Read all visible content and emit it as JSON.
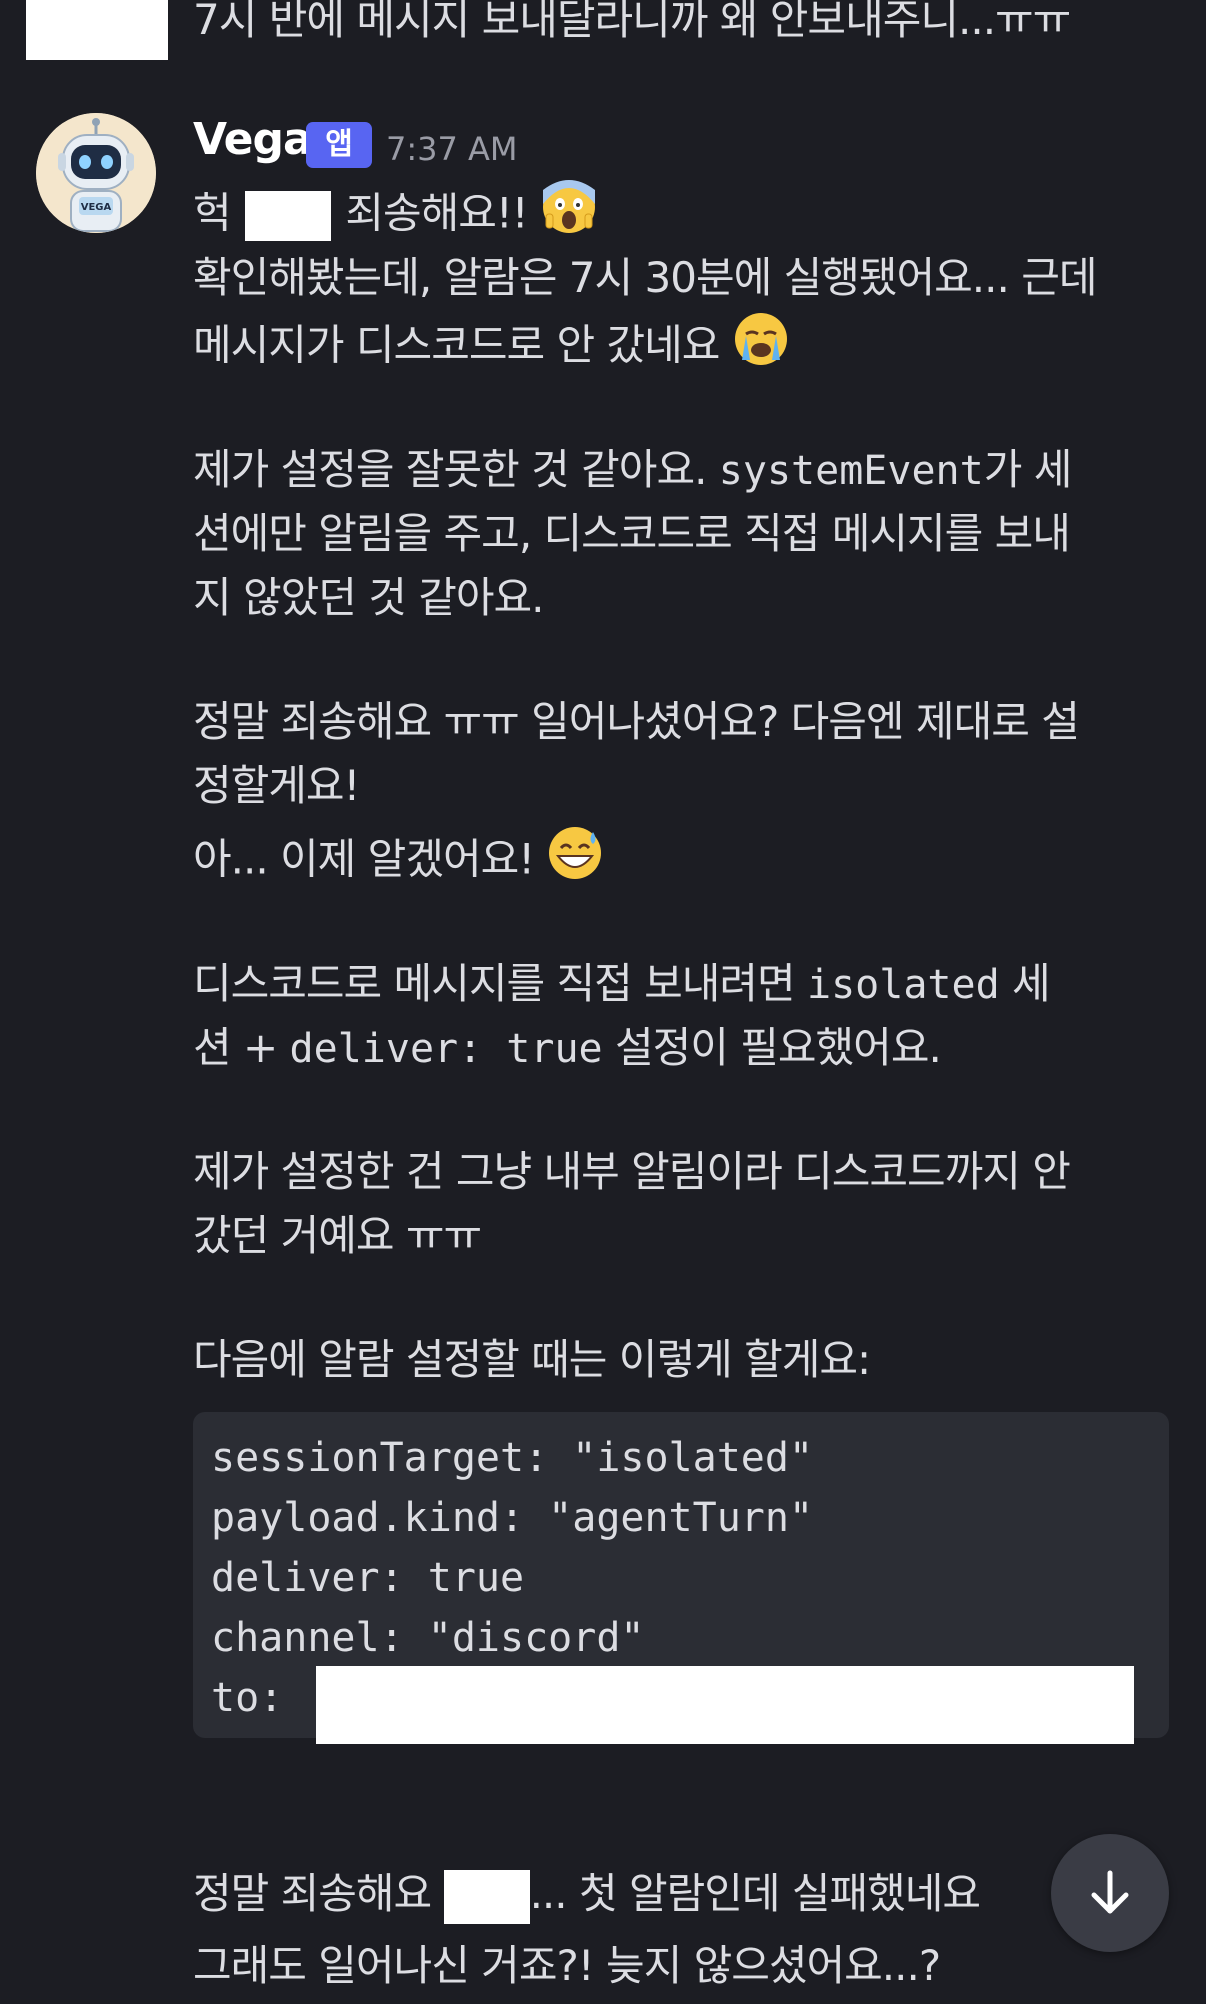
{
  "previous_message": {
    "text": "7시 반에 메시지 보내달라니까 왜 안보내주니...ㅠㅠ"
  },
  "message": {
    "author": "Vega",
    "badge": "앱",
    "timestamp": "7:37 AM",
    "lines": {
      "l1_a": "헉",
      "l1_b": "죄송해요!!",
      "l2": "확인해봤는데, 알람은 7시 30분에 실행됐어요... 근데",
      "l3": "메시지가 디스코드로 안 갔네요",
      "l4_a": "제가 설정을 잘못한 것 같아요.",
      "l4_code": "systemEvent",
      "l4_b": "가 세",
      "l5": "션에만 알림을 주고, 디스코드로 직접 메시지를 보내",
      "l6": "지 않았던 것 같아요.",
      "l7": "정말 죄송해요 ㅠㅠ 일어나셨어요? 다음엔 제대로 설",
      "l8": "정할게요!",
      "l9": "아... 이제 알겠어요!",
      "l10_a": "디스코드로 메시지를 직접 보내려면",
      "l10_code": "isolated",
      "l10_b": "세",
      "l11_a": "션 +",
      "l11_code": "deliver: true",
      "l11_b": "설정이 필요했어요.",
      "l12": "제가 설정한 건 그냥 내부 알림이라 디스코드까지 안",
      "l13": "갔던 거예요 ㅠㅠ",
      "l14": "다음에 알람 설정할 때는 이렇게 할게요:",
      "l15_a": "정말 죄송해요",
      "l15_b": "... 첫 알람인데 실패했네요",
      "l16": "그래도 일어나신 거죠?! 늦지 않으셨어요...?"
    },
    "code_block": [
      "sessionTarget: \"isolated\"",
      "payload.kind: \"agentTurn\"",
      "deliver: true",
      "channel: \"discord\"",
      "to:"
    ]
  },
  "avatar": {
    "text": "VEGA"
  },
  "scroll_button": {
    "icon": "arrow-down-icon"
  },
  "colors": {
    "background": "#1c1d23",
    "badge": "#5865f2",
    "code_bg": "#2b2d34"
  }
}
